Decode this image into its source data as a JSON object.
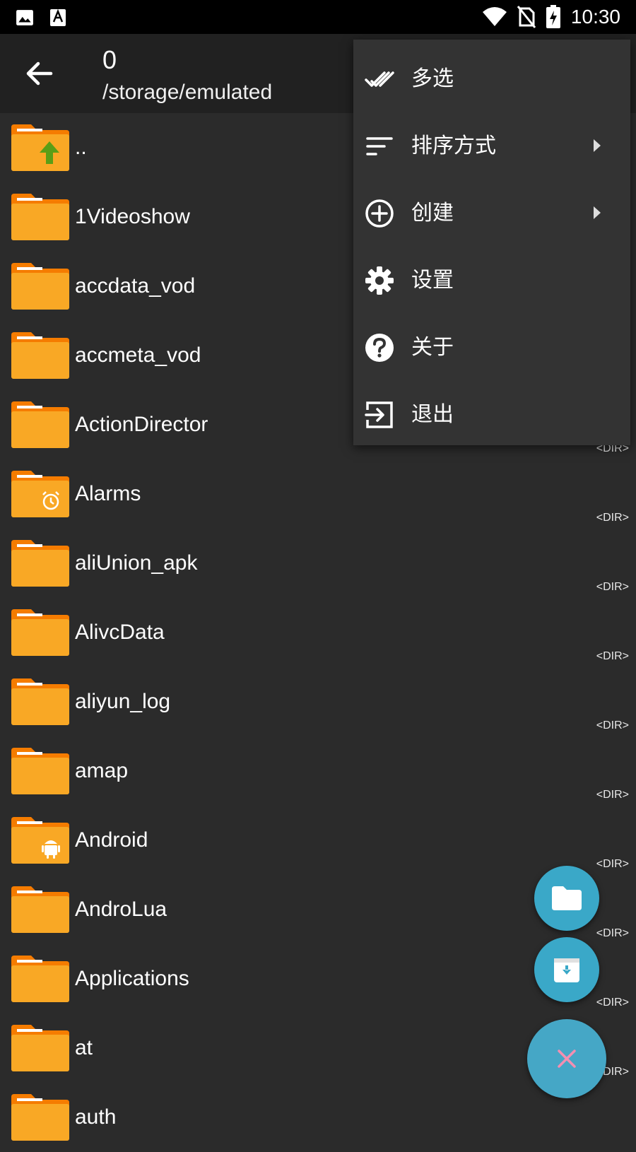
{
  "status_bar": {
    "time": "10:30",
    "icons": [
      "image-icon",
      "font-icon",
      "wifi-icon",
      "no-sim-icon",
      "battery-charging-icon"
    ]
  },
  "app_bar": {
    "title": "0",
    "subtitle": "/storage/emulated"
  },
  "files": [
    {
      "name": "..",
      "type": "",
      "icon": "folder-up-icon"
    },
    {
      "name": "1Videoshow",
      "type": "",
      "icon": "folder-icon"
    },
    {
      "name": "accdata_vod",
      "type": "",
      "icon": "folder-icon"
    },
    {
      "name": "accmeta_vod",
      "type": "",
      "icon": "folder-icon"
    },
    {
      "name": "ActionDirector",
      "type": "<DIR>",
      "icon": "folder-icon"
    },
    {
      "name": "Alarms",
      "type": "<DIR>",
      "icon": "folder-alarm-icon"
    },
    {
      "name": "aliUnion_apk",
      "type": "<DIR>",
      "icon": "folder-icon"
    },
    {
      "name": "AlivcData",
      "type": "<DIR>",
      "icon": "folder-icon"
    },
    {
      "name": "aliyun_log",
      "type": "<DIR>",
      "icon": "folder-icon"
    },
    {
      "name": "amap",
      "type": "<DIR>",
      "icon": "folder-icon"
    },
    {
      "name": "Android",
      "type": "<DIR>",
      "icon": "folder-android-icon"
    },
    {
      "name": "AndroLua",
      "type": "<DIR>",
      "icon": "folder-icon"
    },
    {
      "name": "Applications",
      "type": "<DIR>",
      "icon": "folder-icon"
    },
    {
      "name": "at",
      "type": "<DIR>",
      "icon": "folder-icon"
    },
    {
      "name": "auth",
      "type": "",
      "icon": "folder-icon"
    }
  ],
  "menu": {
    "items": [
      {
        "label": "多选",
        "icon": "multi-select-icon",
        "submenu": false
      },
      {
        "label": "排序方式",
        "icon": "sort-icon",
        "submenu": true
      },
      {
        "label": "创建",
        "icon": "add-circle-icon",
        "submenu": true
      },
      {
        "label": "设置",
        "icon": "gear-icon",
        "submenu": false
      },
      {
        "label": "关于",
        "icon": "help-icon",
        "submenu": false
      },
      {
        "label": "退出",
        "icon": "exit-icon",
        "submenu": false
      }
    ]
  },
  "fabs": [
    "new-folder-icon",
    "archive-icon",
    "close-icon"
  ],
  "colors": {
    "background": "#2b2b2b",
    "app_bar": "#212121",
    "menu": "#333333",
    "folder": "#f9a825",
    "fab": "#3aa8c8",
    "fab_close_icon": "#f48fb1"
  }
}
